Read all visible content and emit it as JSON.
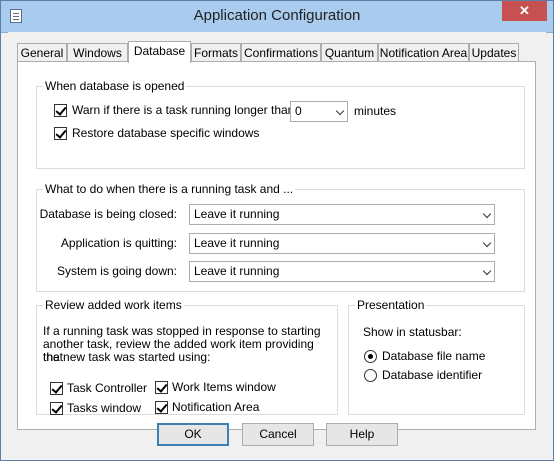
{
  "window": {
    "title": "Application Configuration",
    "close_glyph": "✕"
  },
  "tabs": [
    "General",
    "Windows",
    "Database",
    "Formats",
    "Confirmations",
    "Quantum",
    "Notification Area",
    "Updates"
  ],
  "active_tab": "Database",
  "db_opened": {
    "title": "When database is opened",
    "warn_label": "Warn if there is a task running longer than:",
    "warn_checked": true,
    "warn_value": "0",
    "warn_unit": "minutes",
    "restore_label": "Restore database specific windows",
    "restore_checked": true
  },
  "running_task": {
    "title": "What to do when there is a running task and ...",
    "rows": [
      {
        "label": "Database is being closed:",
        "value": "Leave it running"
      },
      {
        "label": "Application is quitting:",
        "value": "Leave it running"
      },
      {
        "label": "System is going down:",
        "value": "Leave it running"
      }
    ]
  },
  "review": {
    "title": "Review added work items",
    "description_lines": [
      "If a running task was stopped in response to starting",
      "another task, review the added work item providing that",
      "the new task was started using:"
    ],
    "options": [
      {
        "label": "Task Controller",
        "checked": true
      },
      {
        "label": "Work Items window",
        "checked": true
      },
      {
        "label": "Tasks window",
        "checked": true
      },
      {
        "label": "Notification Area",
        "checked": true
      }
    ]
  },
  "presentation": {
    "title": "Presentation",
    "show_label": "Show in statusbar:",
    "options": [
      {
        "label": "Database file name",
        "selected": true
      },
      {
        "label": "Database identifier",
        "selected": false
      }
    ]
  },
  "buttons": {
    "ok": "OK",
    "cancel": "Cancel",
    "help": "Help"
  }
}
